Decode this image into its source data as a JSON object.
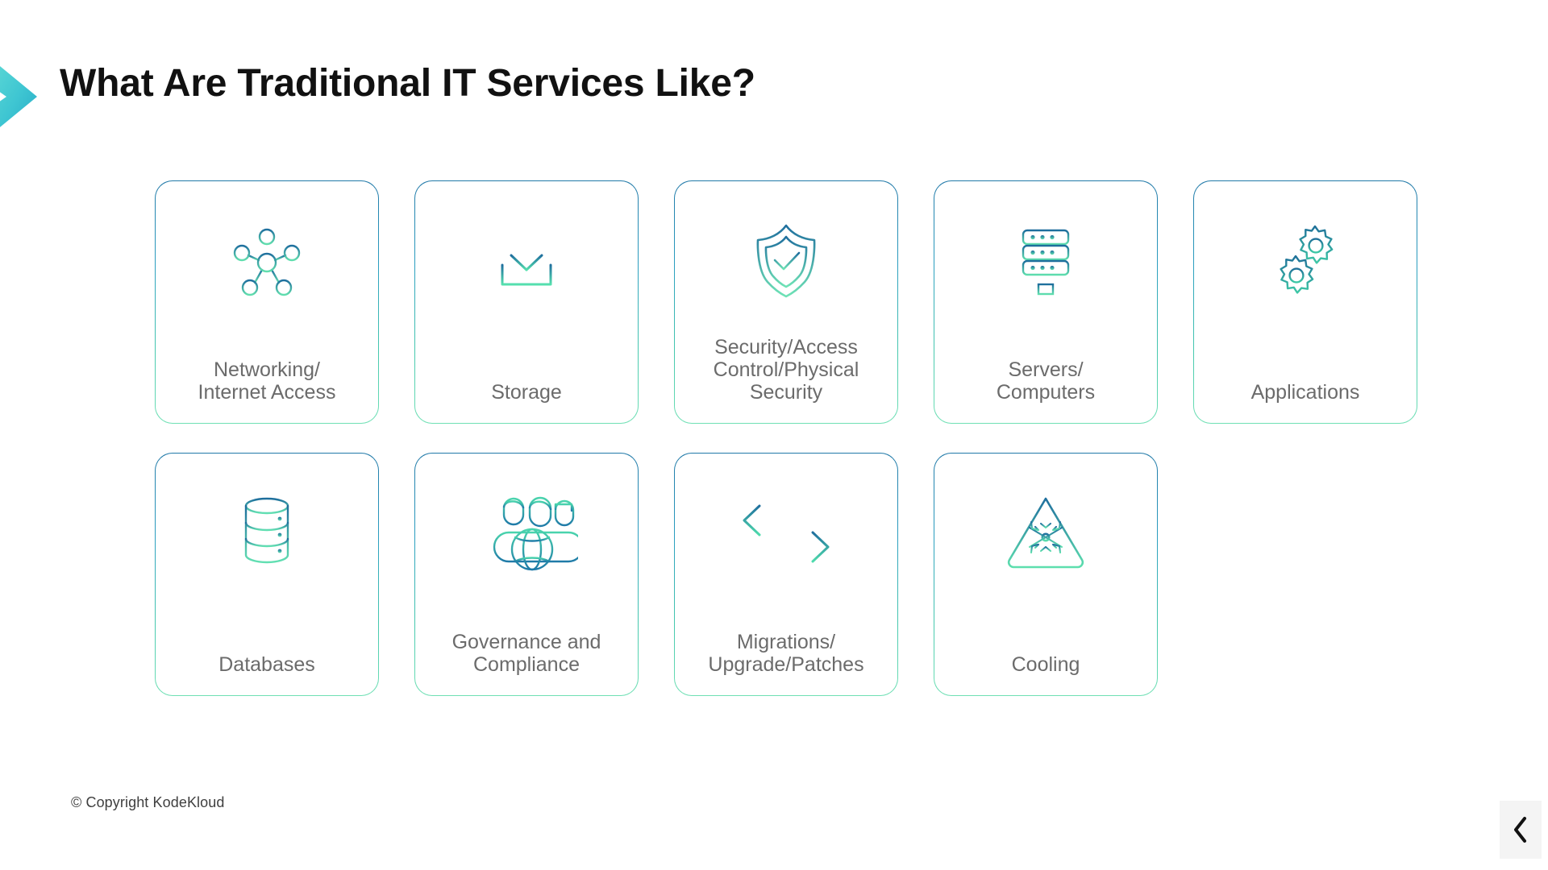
{
  "slide": {
    "title": "What Are Traditional IT Services Like?",
    "accent_icon": "chevron-right-accent",
    "accent_gradient_from": "#5ad6d0",
    "accent_gradient_to": "#2cb5c8",
    "background": "#ffffff",
    "title_color": "#111111"
  },
  "theme": {
    "card_border_top": "#2179a8",
    "card_border_bottom": "#6fe0b4",
    "icon_gradient_from": "#2179a8",
    "icon_gradient_to": "#5fdeb0",
    "label_color": "#6b6b6b"
  },
  "cards": {
    "row1": [
      {
        "label": "Networking/\nInternet Access",
        "icon": "network-nodes-icon"
      },
      {
        "label": "Storage",
        "icon": "download-tray-icon"
      },
      {
        "label": "Security/Access\nControl/Physical\nSecurity",
        "icon": "shield-check-icon"
      },
      {
        "label": "Servers/\nComputers",
        "icon": "server-rack-icon"
      },
      {
        "label": "Applications",
        "icon": "gears-icon"
      }
    ],
    "row2": [
      {
        "label": "Databases",
        "icon": "database-cylinder-icon"
      },
      {
        "label": "Governance and\nCompliance",
        "icon": "people-globe-icon"
      },
      {
        "label": "Migrations/\nUpgrade/Patches",
        "icon": "two-way-arrows-icon"
      },
      {
        "label": "Cooling",
        "icon": "snowflake-triangle-icon"
      }
    ]
  },
  "footer": {
    "copyright": "© Copyright KodeKloud",
    "prev_icon": "chevron-left-icon"
  }
}
